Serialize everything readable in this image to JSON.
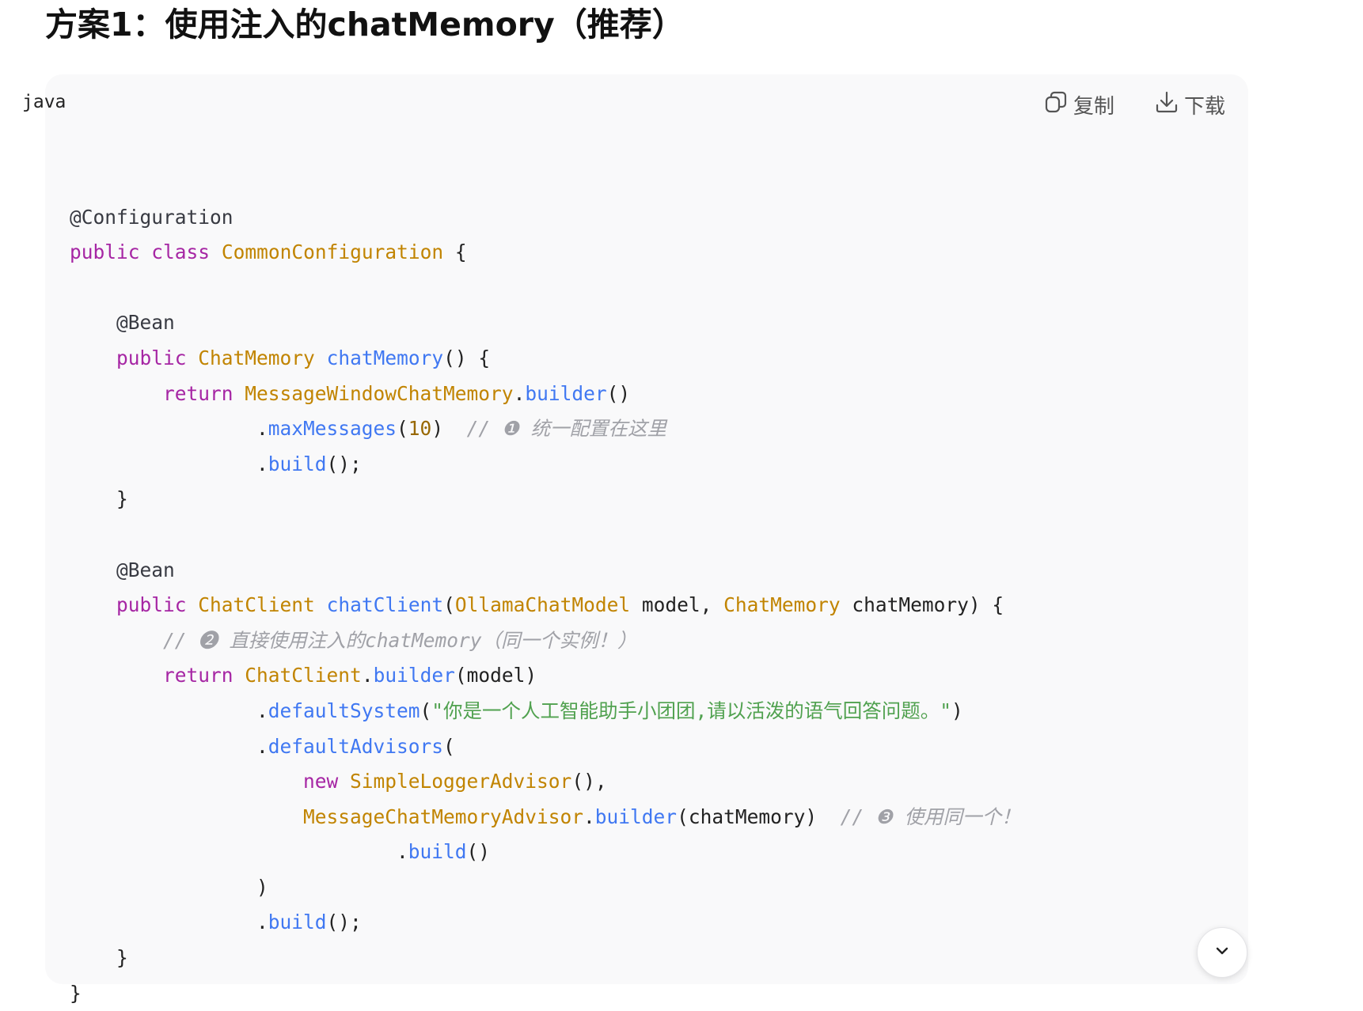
{
  "heading": "方案1：使用注入的chatMemory（推荐）",
  "code_block": {
    "language": "java",
    "copy_label": "复制",
    "download_label": "下载",
    "lines": [
      [],
      [
        {
          "t": "@Configuration",
          "c": "an"
        }
      ],
      [
        {
          "t": "public",
          "c": "kw"
        },
        {
          "t": " "
        },
        {
          "t": "class",
          "c": "kw"
        },
        {
          "t": " "
        },
        {
          "t": "CommonConfiguration",
          "c": "ty"
        },
        {
          "t": " {"
        }
      ],
      [],
      [
        {
          "t": "    "
        },
        {
          "t": "@Bean",
          "c": "an"
        }
      ],
      [
        {
          "t": "    "
        },
        {
          "t": "public",
          "c": "kw"
        },
        {
          "t": " "
        },
        {
          "t": "ChatMemory",
          "c": "ty"
        },
        {
          "t": " "
        },
        {
          "t": "chatMemory",
          "c": "fn"
        },
        {
          "t": "() {"
        }
      ],
      [
        {
          "t": "        "
        },
        {
          "t": "return",
          "c": "kw"
        },
        {
          "t": " "
        },
        {
          "t": "MessageWindowChatMemory",
          "c": "ty"
        },
        {
          "t": "."
        },
        {
          "t": "builder",
          "c": "fn"
        },
        {
          "t": "()"
        }
      ],
      [
        {
          "t": "                ."
        },
        {
          "t": "maxMessages",
          "c": "fn"
        },
        {
          "t": "("
        },
        {
          "t": "10",
          "c": "num"
        },
        {
          "t": ")  "
        },
        {
          "t": "// ❶ 统一配置在这里",
          "c": "cm"
        }
      ],
      [
        {
          "t": "                ."
        },
        {
          "t": "build",
          "c": "fn"
        },
        {
          "t": "();"
        }
      ],
      [
        {
          "t": "    }"
        }
      ],
      [],
      [
        {
          "t": "    "
        },
        {
          "t": "@Bean",
          "c": "an"
        }
      ],
      [
        {
          "t": "    "
        },
        {
          "t": "public",
          "c": "kw"
        },
        {
          "t": " "
        },
        {
          "t": "ChatClient",
          "c": "ty"
        },
        {
          "t": " "
        },
        {
          "t": "chatClient",
          "c": "fn"
        },
        {
          "t": "("
        },
        {
          "t": "OllamaChatModel",
          "c": "ty"
        },
        {
          "t": " model, "
        },
        {
          "t": "ChatMemory",
          "c": "ty"
        },
        {
          "t": " chatMemory) {"
        }
      ],
      [
        {
          "t": "        "
        },
        {
          "t": "// ❷ 直接使用注入的chatMemory（同一个实例！）",
          "c": "cm"
        }
      ],
      [
        {
          "t": "        "
        },
        {
          "t": "return",
          "c": "kw"
        },
        {
          "t": " "
        },
        {
          "t": "ChatClient",
          "c": "ty"
        },
        {
          "t": "."
        },
        {
          "t": "builder",
          "c": "fn"
        },
        {
          "t": "(model)"
        }
      ],
      [
        {
          "t": "                ."
        },
        {
          "t": "defaultSystem",
          "c": "fn"
        },
        {
          "t": "("
        },
        {
          "t": "\"你是一个人工智能助手小团团,请以活泼的语气回答问题。\"",
          "c": "str"
        },
        {
          "t": ")"
        }
      ],
      [
        {
          "t": "                ."
        },
        {
          "t": "defaultAdvisors",
          "c": "fn"
        },
        {
          "t": "("
        }
      ],
      [
        {
          "t": "                    "
        },
        {
          "t": "new",
          "c": "kw"
        },
        {
          "t": " "
        },
        {
          "t": "SimpleLoggerAdvisor",
          "c": "ty"
        },
        {
          "t": "(),"
        }
      ],
      [
        {
          "t": "                    "
        },
        {
          "t": "MessageChatMemoryAdvisor",
          "c": "ty"
        },
        {
          "t": "."
        },
        {
          "t": "builder",
          "c": "fn"
        },
        {
          "t": "(chatMemory)  "
        },
        {
          "t": "// ❸ 使用同一个！",
          "c": "cm"
        }
      ],
      [
        {
          "t": "                            ."
        },
        {
          "t": "build",
          "c": "fn"
        },
        {
          "t": "()"
        }
      ],
      [
        {
          "t": "                )"
        }
      ],
      [
        {
          "t": "                ."
        },
        {
          "t": "build",
          "c": "fn"
        },
        {
          "t": "();"
        }
      ],
      [
        {
          "t": "    }"
        }
      ],
      [
        {
          "t": "}"
        }
      ]
    ]
  },
  "icons": {
    "copy": "copy-icon",
    "download": "download-icon",
    "scroll": "chevron-down-icon"
  }
}
